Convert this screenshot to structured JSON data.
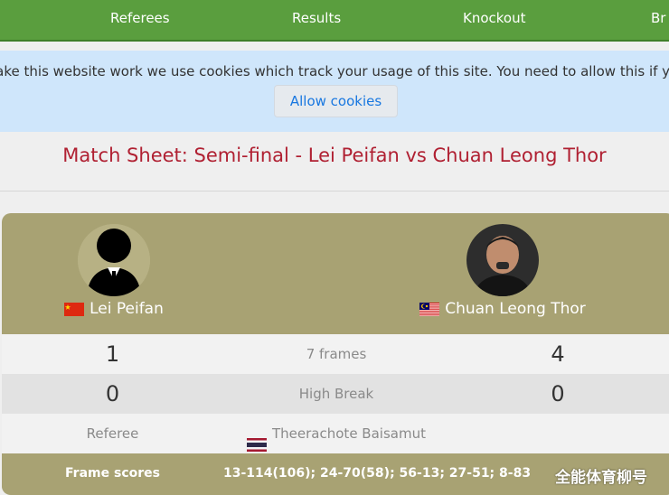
{
  "nav": {
    "items": [
      {
        "label": "Referees"
      },
      {
        "label": "Results"
      },
      {
        "label": "Knockout"
      },
      {
        "label": "Br"
      }
    ]
  },
  "cookie_banner": {
    "message": "To make this website work we use cookies which track your usage of this site. You need to allow this if you wish to continue.",
    "button_label": "Allow cookies"
  },
  "match": {
    "title": "Match Sheet: Semi-final - Lei Peifan vs Chuan Leong Thor",
    "player1": {
      "name": "Lei Peifan",
      "flag_icon": "china-flag-icon",
      "frames": "1",
      "high_break": "0"
    },
    "player2": {
      "name": "Chuan Leong Thor",
      "flag_icon": "malaysia-flag-icon",
      "frames": "4",
      "high_break": "0"
    },
    "format": "7 frames",
    "high_break_label": "High Break",
    "referee_label": "Referee",
    "referee_name": "Theerachote Baisamut",
    "referee_flag_icon": "thailand-flag-icon",
    "frame_scores_label": "Frame scores",
    "frame_scores": "13-114(106); 24-70(58); 56-13; 27-51; 8-83"
  },
  "watermark": "全能体育柳号",
  "colors": {
    "nav_green": "#5a9e3e",
    "cookie_bg": "#cfe6fb",
    "title_red": "#b02032",
    "card_olive": "#a8a273",
    "button_blue": "#1877e0"
  }
}
